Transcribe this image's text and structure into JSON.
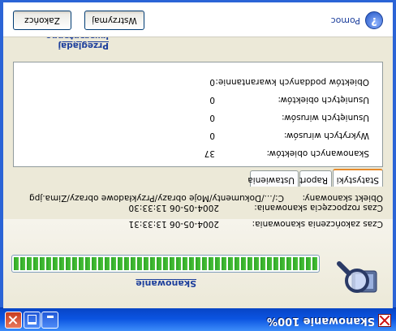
{
  "window": {
    "title": "Skanowanie 100%"
  },
  "scan": {
    "status_label": "Skanowanie",
    "progress_percent": 100,
    "start_label": "Czas rozpoczęcia skanowania:",
    "start_value": "2004-05-06 13:33:30",
    "end_label": "Czas zakończenia skanowania:",
    "end_value": "2004-05-06 13:33:31",
    "object_label": "Obiekt skanowany:",
    "object_value": "C:/.../Dokumenty/Moje obrazy/Przykładowe obrazy/Zima.jpg"
  },
  "tabs": [
    {
      "label": "Statystyki",
      "active": true
    },
    {
      "label": "Raport",
      "active": false
    },
    {
      "label": "Ustawienia",
      "active": false
    }
  ],
  "stats": [
    {
      "label": "Skanowanych obiektów:",
      "value": "37"
    },
    {
      "label": "Wykrytych wirusów:",
      "value": "0"
    },
    {
      "label": "Usuniętych wirusów:",
      "value": "0"
    },
    {
      "label": "Usuniętych obiektów:",
      "value": "0"
    },
    {
      "label": "Obiektów poddanych kwarantannie:",
      "value": "0"
    }
  ],
  "quarantine_link": "Przeglądaj kwarantannę",
  "footer": {
    "help_label": "Pomoc",
    "stop_button": "Wstrzymaj",
    "finish_button": "Zakończ"
  },
  "colors": {
    "title_bar": "#0a53e0",
    "progress": "#2ea524",
    "link": "#1d3f9c"
  }
}
